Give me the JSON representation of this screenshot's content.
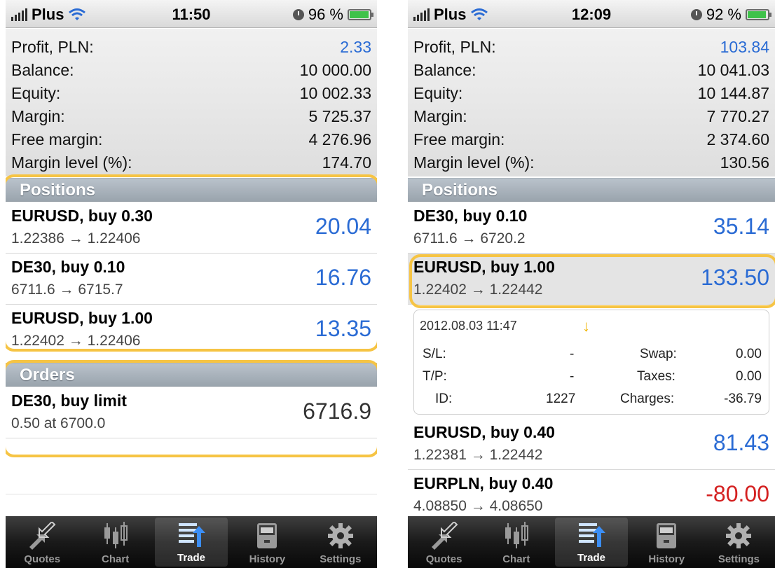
{
  "left": {
    "status": {
      "carrier": "Plus",
      "time": "11:50",
      "battery": "96 %",
      "battery_level": 0.96
    },
    "summary": [
      {
        "label": "Profit, PLN:",
        "value": "2.33",
        "blue": true
      },
      {
        "label": "Balance:",
        "value": "10 000.00"
      },
      {
        "label": "Equity:",
        "value": "10 002.33"
      },
      {
        "label": "Margin:",
        "value": "5 725.37"
      },
      {
        "label": "Free margin:",
        "value": "4 276.96"
      },
      {
        "label": "Margin level (%):",
        "value": "174.70"
      }
    ],
    "positions_header": "Positions",
    "positions": [
      {
        "title": "EURUSD, buy 0.30",
        "sub": "1.22386 → 1.22406",
        "value": "20.04"
      },
      {
        "title": "DE30, buy 0.10",
        "sub": "6711.6 → 6715.7",
        "value": "16.76"
      },
      {
        "title": "EURUSD, buy 1.00",
        "sub": "1.22402 → 1.22406",
        "value": "13.35"
      }
    ],
    "orders_header": "Orders",
    "orders": [
      {
        "title": "DE30, buy limit",
        "sub": "0.50 at 6700.0",
        "value": "6716.9"
      }
    ]
  },
  "right": {
    "status": {
      "carrier": "Plus",
      "time": "12:09",
      "battery": "92 %",
      "battery_level": 0.92
    },
    "summary": [
      {
        "label": "Profit, PLN:",
        "value": "103.84",
        "blue": true
      },
      {
        "label": "Balance:",
        "value": "10 041.03"
      },
      {
        "label": "Equity:",
        "value": "10 144.87"
      },
      {
        "label": "Margin:",
        "value": "7 770.27"
      },
      {
        "label": "Free margin:",
        "value": "2 374.60"
      },
      {
        "label": "Margin level (%):",
        "value": "130.56"
      }
    ],
    "positions_header": "Positions",
    "positions": [
      {
        "title": "DE30, buy 0.10",
        "sub": "6711.6 → 6720.2",
        "value": "35.14"
      },
      {
        "title": "EURUSD, buy 1.00",
        "sub": "1.22402 → 1.22442",
        "value": "133.50"
      },
      {
        "title": "EURUSD, buy 0.40",
        "sub": "1.22381 → 1.22442",
        "value": "81.43"
      },
      {
        "title": "EURPLN, buy 0.40",
        "sub": "4.08850 → 4.08650",
        "value": "-80.00"
      }
    ],
    "details": {
      "date": "2012.08.03 11:47",
      "sl_label": "S/L:",
      "sl_value": "-",
      "tp_label": "T/P:",
      "tp_value": "-",
      "id_label": "ID:",
      "id_value": "1227",
      "swap_label": "Swap:",
      "swap_value": "0.00",
      "taxes_label": "Taxes:",
      "taxes_value": "0.00",
      "charges_label": "Charges:",
      "charges_value": "-36.79"
    }
  },
  "tabs": [
    {
      "label": "Quotes",
      "icon": "quotes-arrows-icon"
    },
    {
      "label": "Chart",
      "icon": "candlestick-chart-icon"
    },
    {
      "label": "Trade",
      "icon": "trade-list-icon",
      "active": true
    },
    {
      "label": "History",
      "icon": "history-cabinet-icon"
    },
    {
      "label": "Settings",
      "icon": "gear-icon"
    }
  ],
  "colors": {
    "accent_blue": "#2a6bd4",
    "loss_red": "#d42020",
    "highlight": "#f6c444",
    "battery_green": "#3fc24a"
  }
}
